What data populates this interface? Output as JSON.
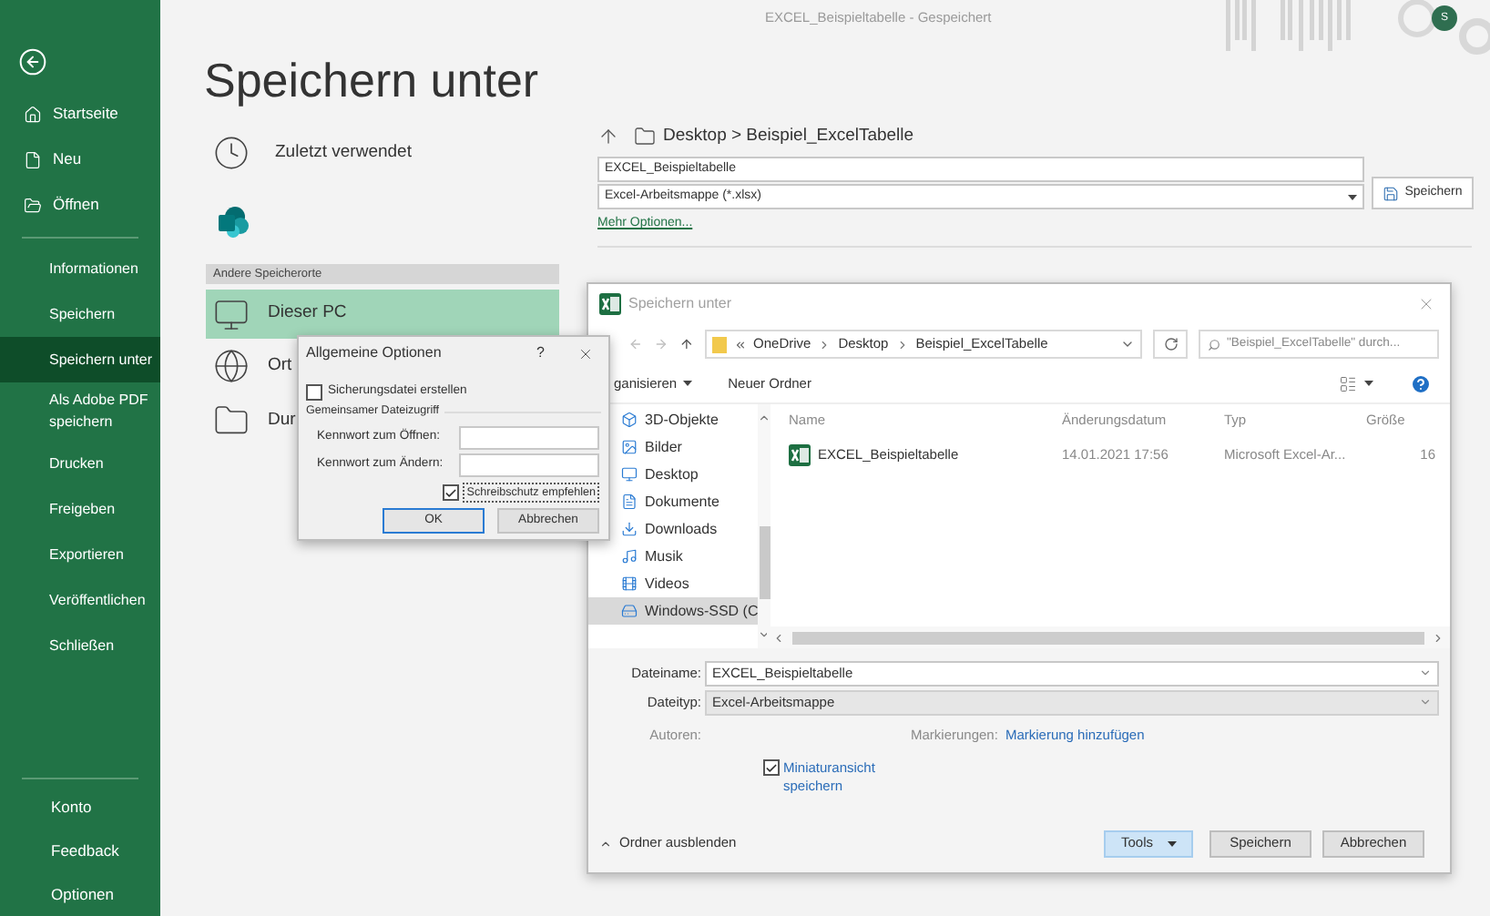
{
  "title_bar": {
    "document": "EXCEL_Beispieltabelle",
    "separator": "-",
    "status": "Gespeichert",
    "avatar": "S"
  },
  "sidebar": {
    "primary": [
      {
        "label": "Startseite"
      },
      {
        "label": "Neu"
      },
      {
        "label": "Öffnen"
      }
    ],
    "items": [
      {
        "label": "Informationen",
        "selected": false
      },
      {
        "label": "Speichern",
        "selected": false
      },
      {
        "label": "Speichern unter",
        "selected": true
      },
      {
        "label": "Als Adobe PDF speichern",
        "selected": false
      },
      {
        "label": "Drucken",
        "selected": false
      },
      {
        "label": "Freigeben",
        "selected": false
      },
      {
        "label": "Exportieren",
        "selected": false
      },
      {
        "label": "Veröffentlichen",
        "selected": false
      },
      {
        "label": "Schließen",
        "selected": false
      }
    ],
    "footer": [
      {
        "label": "Konto"
      },
      {
        "label": "Feedback"
      },
      {
        "label": "Optionen"
      }
    ]
  },
  "heading": "Speichern unter",
  "places": {
    "recent": "Zuletzt verwendet",
    "other_header": "Andere Speicherorte",
    "locations": [
      {
        "label": "Dieser PC",
        "selected": true
      },
      {
        "label": "Ort",
        "selected": false
      },
      {
        "label": "Dur",
        "selected": false
      }
    ]
  },
  "save_pane": {
    "breadcrumb": "Desktop > Beispiel_ExcelTabelle",
    "filename": "EXCEL_Beispieltabelle",
    "filetype": "Excel-Arbeitsmappe (*.xlsx)",
    "save_button": "Speichern",
    "more_options": "Mehr Optionen..."
  },
  "save_dialog": {
    "title": "Speichern unter",
    "path": [
      "OneDrive",
      "Desktop",
      "Beispiel_ExcelTabelle"
    ],
    "search": {
      "placeholder": "\"Beispiel_ExcelTabelle\" durch..."
    },
    "toolbar": {
      "organize": "ganisieren",
      "new_folder": "Neuer Ordner"
    },
    "nav": [
      {
        "label": "3D-Objekte",
        "selected": false
      },
      {
        "label": "Bilder",
        "selected": false
      },
      {
        "label": "Desktop",
        "selected": false
      },
      {
        "label": "Dokumente",
        "selected": false
      },
      {
        "label": "Downloads",
        "selected": false
      },
      {
        "label": "Musik",
        "selected": false
      },
      {
        "label": "Videos",
        "selected": false
      },
      {
        "label": "Windows-SSD (C",
        "selected": true
      }
    ],
    "columns": [
      "Name",
      "Änderungsdatum",
      "Typ",
      "Größe"
    ],
    "rows": [
      {
        "name": "EXCEL_Beispieltabelle",
        "date": "14.01.2021 17:56",
        "type": "Microsoft Excel-Ar...",
        "size": "16"
      }
    ],
    "filename_label": "Dateiname:",
    "filename": "EXCEL_Beispieltabelle",
    "filetype_label": "Dateityp:",
    "filetype": "Excel-Arbeitsmappe",
    "authors_label": "Autoren:",
    "tags_label": "Markierungen:",
    "tags_link": "Markierung hinzufügen",
    "thumbnail": {
      "label": "Miniaturansicht speichern",
      "checked": true
    },
    "hide_folders": "Ordner ausblenden",
    "tools": "Tools",
    "save": "Speichern",
    "cancel": "Abbrechen"
  },
  "options_dialog": {
    "title": "Allgemeine Optionen",
    "help": "?",
    "backup": {
      "label": "Sicherungsdatei erstellen",
      "checked": false
    },
    "section": "Gemeinsamer Dateizugriff",
    "open_password_label": "Kennwort zum Öffnen:",
    "modify_password_label": "Kennwort zum Ändern:",
    "read_only": {
      "label": "Schreibschutz empfehlen",
      "checked": true
    },
    "ok": "OK",
    "cancel": "Abbrechen"
  }
}
